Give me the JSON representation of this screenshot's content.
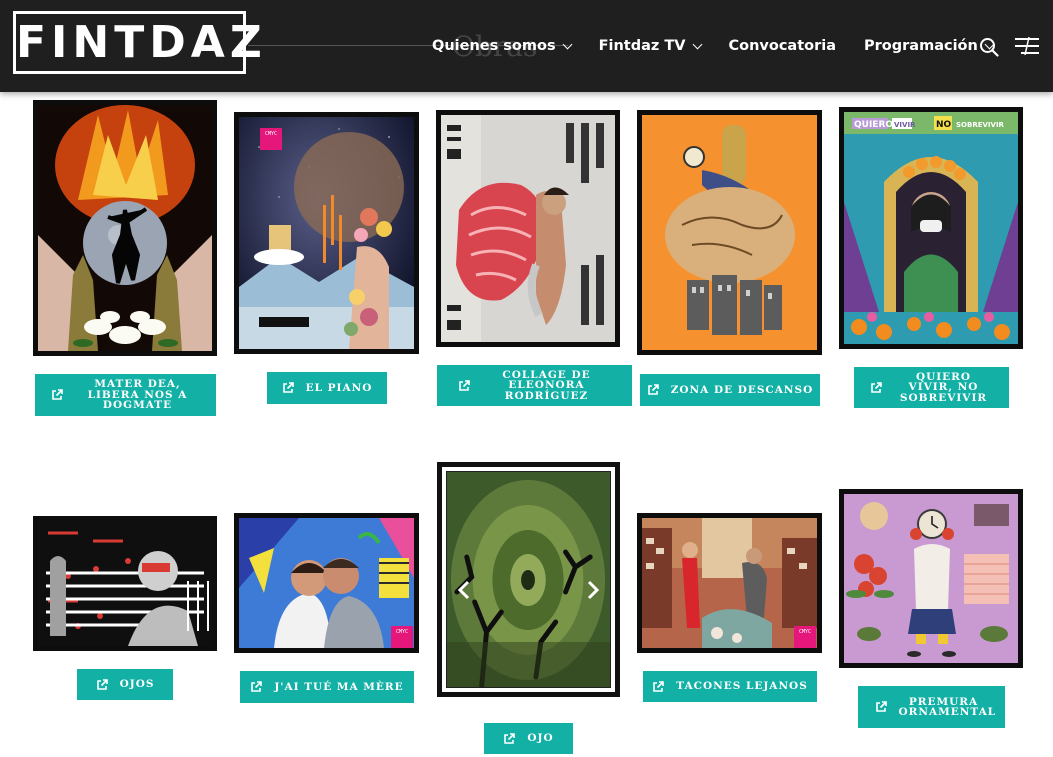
{
  "header": {
    "logo": "FINTDAZ",
    "ghost_title": "Obras",
    "nav": [
      {
        "label": "Quienes somos",
        "has_dropdown": true
      },
      {
        "label": "Fintdaz TV",
        "has_dropdown": true
      },
      {
        "label": "Convocatoria",
        "has_dropdown": false
      },
      {
        "label": "Programación",
        "has_dropdown": true
      }
    ],
    "icons": {
      "search": "search-icon",
      "menu": "hamburger-menu-icon"
    }
  },
  "colors": {
    "header_bg": "#1f1f1f",
    "button_teal": "#13b0a5",
    "frame": "#0d0d0d"
  },
  "works": [
    {
      "title": "Mater Dea, libera nos a Dogmate"
    },
    {
      "title": "El piano"
    },
    {
      "title": "Collage de Eleonora Rodríguez"
    },
    {
      "title": "Zona de descanso"
    },
    {
      "title": "Quiero vivir, no sobrevivir"
    },
    {
      "title": "Ojos"
    },
    {
      "title": "J'ai tué ma mère"
    },
    {
      "title": "Ojo"
    },
    {
      "title": "Tacones lejanos"
    },
    {
      "title": "Premura ornamental"
    }
  ],
  "badges": {
    "cmyk": "CMYC"
  },
  "poster_text": {
    "quiero": "QUIERO",
    "vivir": "VIVIR",
    "no": "NO",
    "sobrevivir": "SOBREVIVIR"
  }
}
